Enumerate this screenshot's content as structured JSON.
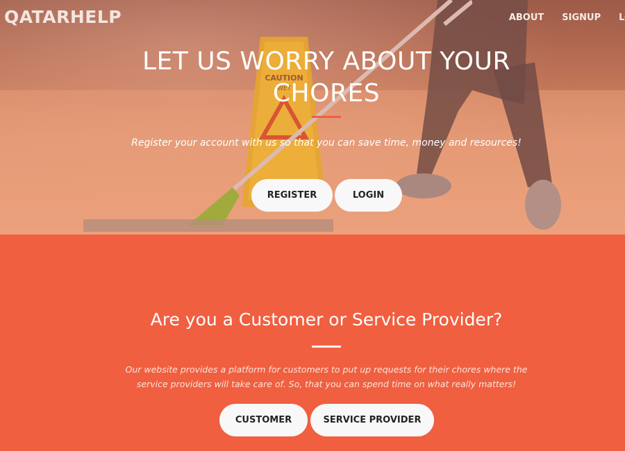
{
  "brand": "QATARHELP",
  "nav": {
    "items": [
      "ABOUT",
      "SIGNUP",
      "LO"
    ]
  },
  "hero": {
    "title": "LET US WORRY ABOUT YOUR CHORES",
    "subtitle": "Register your account with us so that you can save time, money and resources!",
    "register_label": "REGISTER",
    "login_label": "LOGIN",
    "sign_text": "CAUTION WET"
  },
  "section": {
    "title": "Are you a Customer or Service Provider?",
    "text": "Our website provides a platform for customers to put up requests for their chores where the service providers will take care of. So, that you can spend time on what really matters!",
    "customer_label": "CUSTOMER",
    "provider_label": "SERVICE PROVIDER"
  },
  "colors": {
    "accent": "#f05f40",
    "button_bg": "#f8f8f8",
    "text_light": "#ffffff"
  }
}
